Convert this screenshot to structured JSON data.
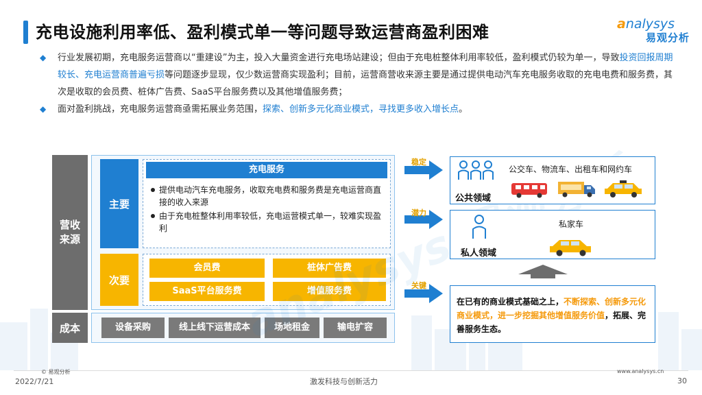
{
  "header": {
    "title": "充电设施利用率低、盈利模式单一等问题导致运营商盈利困难",
    "logo_en_first": "a",
    "logo_en_rest": "nalysys",
    "logo_cn": "易观分析"
  },
  "bullets": [
    {
      "p1": "行业发展初期，充电服务运营商以“重建设”为主，投入大量资金进行充电场站建设；但由于充电桩整体利用率较低，盈利模式仍较为单一，导致",
      "hl": "投资回报周期较长、充电运营商普遍亏损",
      "p2": "等问题逐步显现，仅少数运营商实现盈利；目前，运营商营收来源主要是通过提供电动汽车充电服务收取的充电电费和服务费，其次是收取的会员费、桩体广告费、SaaS平台服务费以及其他增值服务费；"
    },
    {
      "p1": "面对盈利挑战，充电服务运营商亟需拓展业务范围，",
      "hl": "探索、创新多元化商业模式，寻找更多收入增长点",
      "p2": "。"
    }
  ],
  "diagram": {
    "revenue_label": "营收来源",
    "cost_label": "成本",
    "main_tag": "主要",
    "main_head": "充电服务",
    "main_items": [
      "提供电动汽车充电服务，收取充电费和服务费是充电运营商直接的收入来源",
      "由于充电桩整体利用率较低，充电运营模式单一，较难实现盈利"
    ],
    "secondary_tag": "次要",
    "secondary_items": [
      "会员费",
      "桩体广告费",
      "SaaS平台服务费",
      "增值服务费"
    ],
    "cost_items": [
      "设备采购",
      "线上线下运营成本",
      "场地租金",
      "输电扩容"
    ],
    "arrow_labels": [
      "稳定",
      "潜力",
      "关键"
    ],
    "public": {
      "title": "公共领域",
      "text": "公交车、物流车、出租车和网约车"
    },
    "private": {
      "title": "私人领域",
      "text": "私家车"
    },
    "key": {
      "p1": "在已有的商业模式基础之上，",
      "hl": "不断探索、创新多元化商业模式，进一步挖掘其他增值服务价值",
      "p2": "，拓展、完善服务生态。"
    }
  },
  "footer": {
    "copyright": "© 易观分析",
    "date": "2022/7/21",
    "slogan": "激发科技与创新活力",
    "site": "www.analysys.cn",
    "page": "30"
  },
  "colors": {
    "blue": "#1f7fd1",
    "yellow": "#f7b500",
    "gray": "#6d6d6d",
    "orange": "#f59a0c"
  }
}
